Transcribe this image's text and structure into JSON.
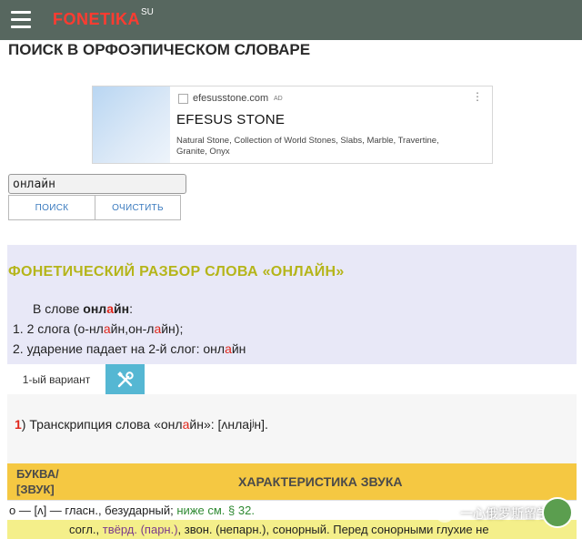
{
  "header": {
    "logo": "FONETIKA",
    "logo_suffix": "SU"
  },
  "page_title": "ПОИСК В ОРФОЭПИЧЕСКОМ СЛОВАРЕ",
  "ad": {
    "domain": "efesusstone.com",
    "badge": "AD",
    "more": "⋮",
    "headline": "EFESUS STONE",
    "description": "Natural Stone, Collection of World Stones, Slabs, Marble, Travertine, Granite, Onyx"
  },
  "search": {
    "value": "онлайн",
    "search_label": "ПОИСК",
    "clear_label": "ОЧИСТИТЬ"
  },
  "analysis": {
    "title": "ФОНЕТИЧЕСКИЙ РАЗБОР СЛОВА «ОНЛАЙН»",
    "intro_prefix": "В слове ",
    "word_before": "онл",
    "word_stress": "а",
    "word_after": "йн",
    "intro_suffix": ":",
    "line2_a": "1. 2 слога (о-нл",
    "line2_s1": "а",
    "line2_b": "йн,он-л",
    "line2_s2": "а",
    "line2_c": "йн);",
    "line3_a": "2. ударение падает на 2-й слог: онл",
    "line3_s": "а",
    "line3_b": "йн"
  },
  "variant": {
    "tab_label": "1-ый вариант"
  },
  "transcription": {
    "num": "1",
    "text_a": ") Транскрипция слова «онл",
    "text_s": "а",
    "text_b": "йн»: [ʌнлаj",
    "text_c": "ʲн].",
    "stress_mark": "́"
  },
  "table": {
    "col1_line1": "БУКВА/",
    "col1_line2": "[ЗВУК]",
    "col2": "ХАРАКТЕРИСТИКА ЗВУКА",
    "row1_a": "о — [ʌ] — гласн., безударный; ",
    "row1_link": "ниже см. § 32.",
    "row2_a": "согл., ",
    "row2_b": "твёрд. (парн.)",
    "row2_c": ", звон. (непарн.), сонорный. Перед сонорными глухие не"
  },
  "watermark": {
    "text": "一心俄罗斯留学"
  }
}
